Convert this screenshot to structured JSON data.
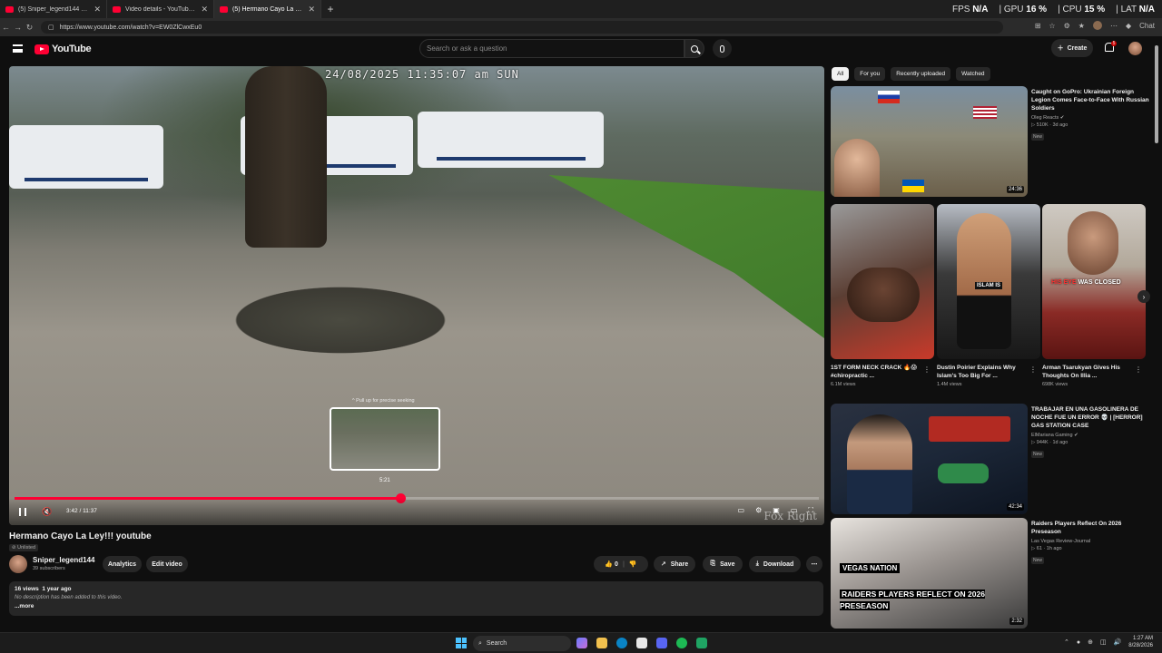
{
  "browser": {
    "tabs": [
      {
        "label": "(5) Sniper_legend144 - YouTube",
        "active": false
      },
      {
        "label": "Video details - YouTube Studio",
        "active": false
      },
      {
        "label": "(5) Hermano Cayo La Ley!!! youtube",
        "active": true
      }
    ],
    "url": "https://www.youtube.com/watch?v=EW0ZlCwxEu0",
    "chat_label": "Chat"
  },
  "perf": {
    "fps_label": "FPS",
    "fps": "N/A",
    "gpu_label": "GPU",
    "gpu": "16 %",
    "cpu_label": "CPU",
    "cpu": "15 %",
    "lat_label": "LAT",
    "lat": "N/A"
  },
  "header": {
    "logo_text": "YouTube",
    "search_placeholder": "Search or ask a question",
    "create_label": "Create",
    "notif_count": "5"
  },
  "player": {
    "timestamp": "24/08/2025 11:35:07 am SUN",
    "seek_hint": "^ Pull up for precise seeking",
    "seek_time": "5:21",
    "current_time": "3:42",
    "separator": " / ",
    "duration": "11:37",
    "progress_fraction": 0.48,
    "watermark": "Fox Right"
  },
  "video": {
    "title": "Hermano Cayo La Ley!!! youtube",
    "visibility": "Unlisted",
    "channel": "Sniper_legend144",
    "subscribers": "39 subscribers",
    "analytics_label": "Analytics",
    "edit_label": "Edit video",
    "likes": "0",
    "share_label": "Share",
    "save_label": "Save",
    "download_label": "Download",
    "views": "16 views",
    "age": "1 year ago",
    "description": "No description has been added to this video.",
    "more_label": "...more"
  },
  "chips": [
    "All",
    "For you",
    "Recently uploaded",
    "Watched"
  ],
  "recommendations": [
    {
      "title": "Caught on GoPro: Ukrainian Foreign Legion Comes Face-to-Face With Russian Soldiers",
      "channel": "Oleg Reacts",
      "stats": "510K · 3d ago",
      "badge": "New",
      "duration": "24:36"
    },
    {
      "title": "TRABAJAR EN UNA GASOLINERA DE NOCHE FUE UN ERROR 💀 | [HERROR] GAS STATION CASE",
      "channel": "ElMariana Gaming",
      "stats": "944K · 1d ago",
      "badge": "New",
      "duration": "42:34"
    },
    {
      "title": "Raiders Players Reflect On 2026 Preseason",
      "channel": "Las Vegas Review-Journal",
      "stats": "61 · 1h ago",
      "badge": "New",
      "duration": "2:32",
      "overlay": "RAIDERS PLAYERS REFLECT ON 2026 PRESEASON",
      "overlay_brand": "VEGAS NATION"
    }
  ],
  "shorts": [
    {
      "title": "1ST FORM NECK CRACK 🔥😱 #chiropractic ...",
      "views": "6.1M views"
    },
    {
      "title": "Dustin Poirier Explains Why Islam's Too Big For ...",
      "views": "1.4M views",
      "overlay": "ISLAM IS"
    },
    {
      "title": "Arman Tsarukyan Gives His Thoughts On Illia ...",
      "views": "698K views",
      "overlay_pre": "HIS EYE",
      "overlay_post": " WAS CLOSED"
    }
  ],
  "taskbar": {
    "search_label": "Search",
    "time": "1:27 AM",
    "date": "8/28/2026"
  },
  "colors": {
    "accent": "#ff0033",
    "background": "#0f0f0f",
    "surface": "#272727"
  }
}
